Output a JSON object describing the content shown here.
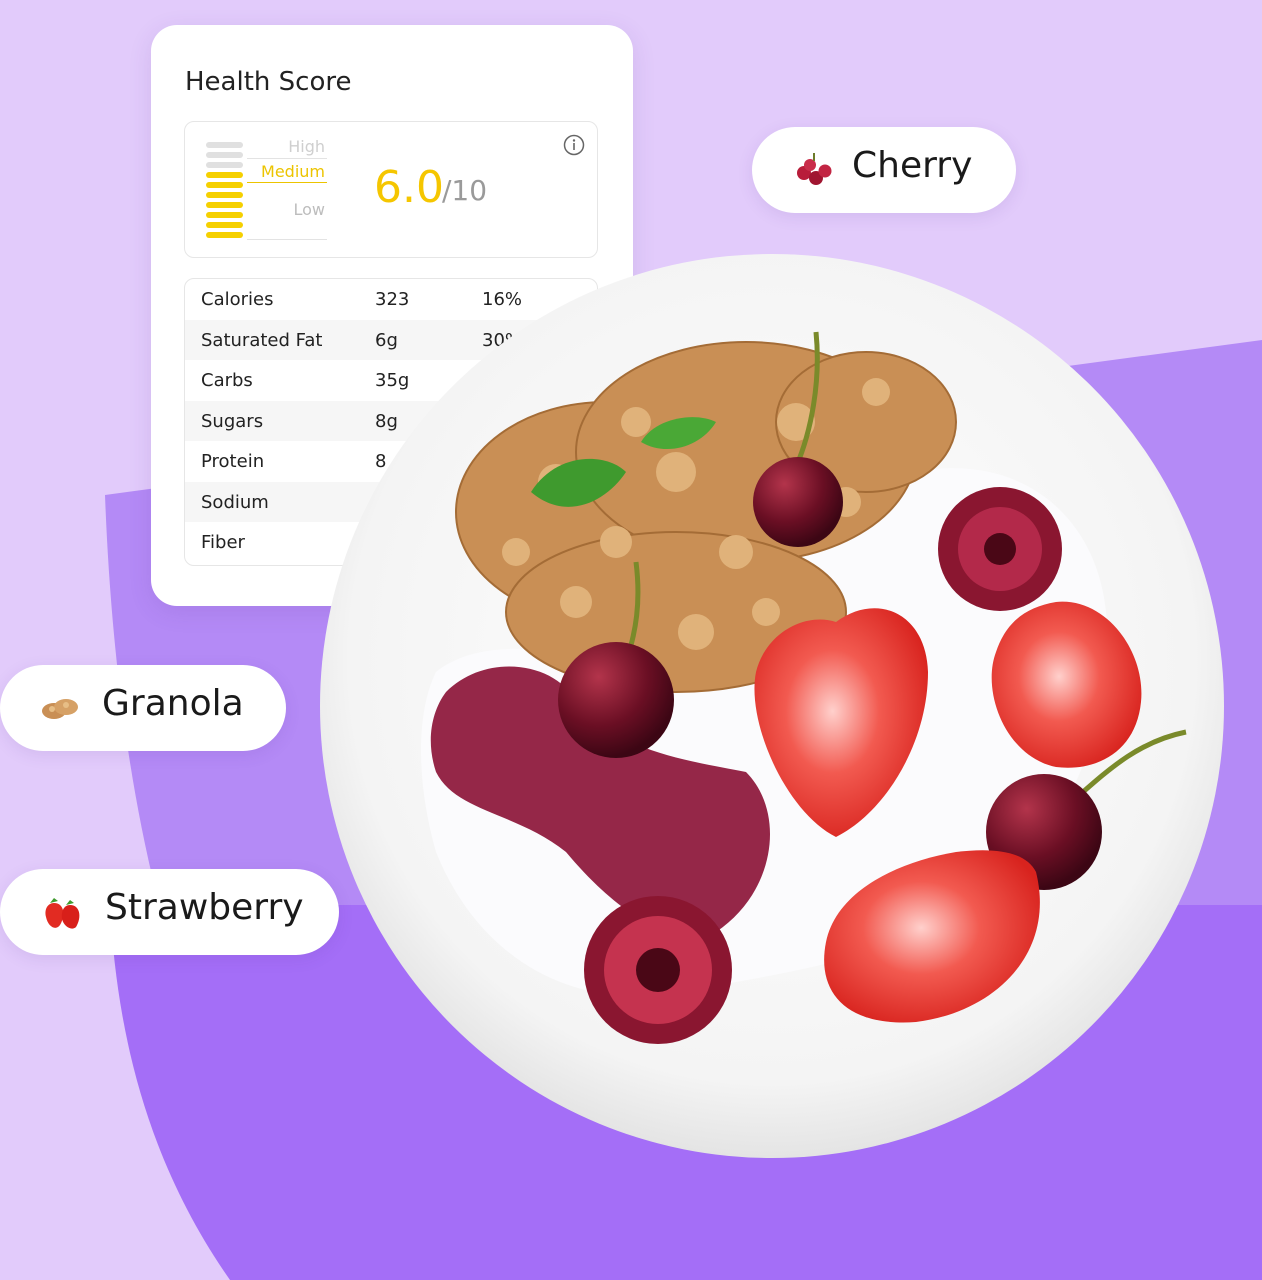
{
  "health_card": {
    "title": "Health Score",
    "levels": {
      "high": "High",
      "medium": "Medium",
      "low": "Low"
    },
    "score": "6.0",
    "score_max": "/10",
    "score_fraction": 0.6,
    "info_icon": "info-icon"
  },
  "nutrition": [
    {
      "name": "Calories",
      "amount": "323",
      "percent": "16%"
    },
    {
      "name": "Saturated Fat",
      "amount": "6g",
      "percent": "30%"
    },
    {
      "name": "Carbs",
      "amount": "35g",
      "percent": ""
    },
    {
      "name": "Sugars",
      "amount": "8g",
      "percent": ""
    },
    {
      "name": "Protein",
      "amount": "8",
      "percent": ""
    },
    {
      "name": "Sodium",
      "amount": "",
      "percent": ""
    },
    {
      "name": "Fiber",
      "amount": "",
      "percent": ""
    }
  ],
  "tags": {
    "cherry": {
      "label": "Cherry",
      "icon": "cherry-icon"
    },
    "granola": {
      "label": "Granola",
      "icon": "granola-icon"
    },
    "strawberry": {
      "label": "Strawberry",
      "icon": "strawberry-icon"
    }
  },
  "colors": {
    "background": "#e2cbfb",
    "accent_purple": "#a46ef7",
    "score_yellow": "#f5c600",
    "meter_empty": "#e0e0e0"
  }
}
